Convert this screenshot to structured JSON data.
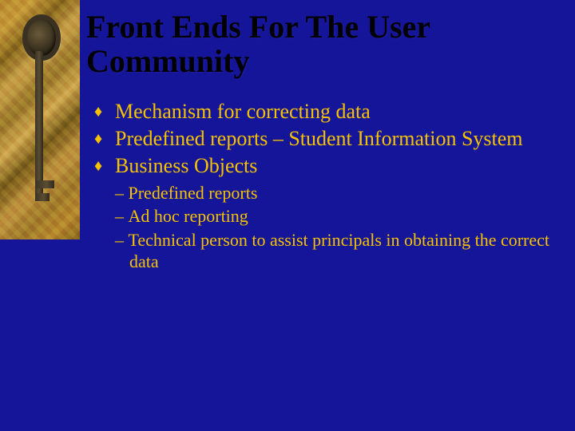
{
  "title": "Front Ends For The User Community",
  "bullets": {
    "b0": "Mechanism for correcting data",
    "b1": "Predefined reports – Student Information System",
    "b2": "Business Objects"
  },
  "subbullets": {
    "s0": "Predefined reports",
    "s1": "Ad hoc reporting",
    "s2": "Technical person to assist principals in obtaining the correct data"
  }
}
